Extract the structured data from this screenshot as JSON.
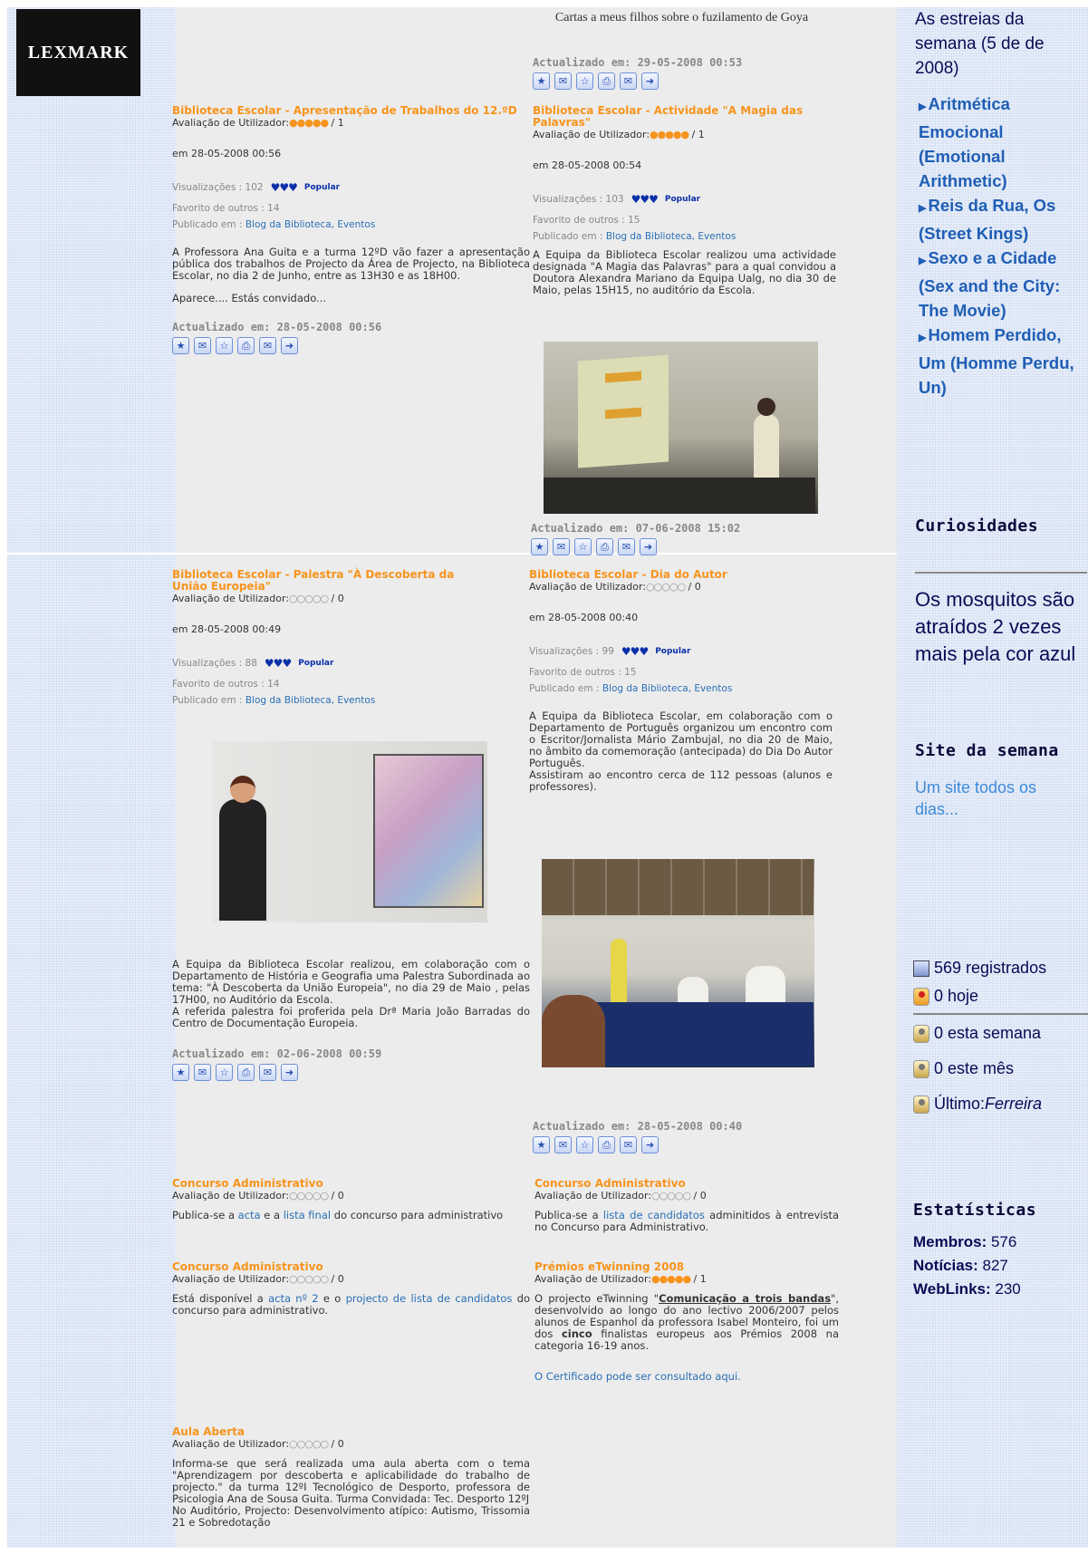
{
  "logo": {
    "text": "LEXMARK"
  },
  "top_right_article": {
    "title": "Cartas a meus filhos sobre o fuzilamento de Goya",
    "updated": "Actualizado em: 29-05-2008 00:53"
  },
  "articles": [
    {
      "title": "Biblioteca Escolar - Apresentação de Trabalhos do 12.ºD",
      "rating_label": "Avaliação de Utilizador:",
      "rating_stars": "●●●●●",
      "rating_count": " / 1",
      "date": "em 28-05-2008 00:56",
      "views": "Visualizações : 102",
      "popular": "Popular",
      "fav": "Favorito de outros : 14",
      "pub_label": "Publicado em : ",
      "pub_links": "Blog da Biblioteca, Eventos",
      "body": [
        "A Professora Ana Guita e a turma 12ºD vão fazer a apresentação pública dos trabalhos de Projecto da Área de Projecto, na Biblioteca Escolar, no dia 2 de Junho, entre as 13H30 e as 18H00.",
        "Aparece.... Estás convidado..."
      ],
      "updated": "Actualizado em: 28-05-2008 00:56"
    },
    {
      "title": "Biblioteca Escolar - Actividade \"A Magia das Palavras\"",
      "rating_label": "Avaliação de Utilizador:",
      "rating_stars": "●●●●●",
      "rating_count": " / 1",
      "date": "em 28-05-2008 00:54",
      "views": "Visualizações : 103",
      "popular": "Popular",
      "fav": "Favorito de outros : 15",
      "pub_label": "Publicado em : ",
      "pub_links": "Blog da Biblioteca, Eventos",
      "body": [
        "A Equipa da Biblioteca Escolar realizou uma actividade designada \"A Magia das Palavras\" para a qual convidou a Doutora Alexandra Mariano da Equipa Ualg, no dia 30 de Maio, pelas 15H15, no auditório da Escola."
      ],
      "updated": "Actualizado em: 07-06-2008 15:02"
    },
    {
      "title": "Biblioteca Escolar - Palestra \"À Descoberta da União Europeia\"",
      "rating_label": "Avaliação de Utilizador:",
      "rating_stars": "○○○○○",
      "rating_count": " / 0",
      "date": "em 28-05-2008 00:49",
      "views": "Visualizações : 88",
      "popular": "Popular",
      "fav": "Favorito de outros : 14",
      "pub_label": "Publicado em : ",
      "pub_links": "Blog da Biblioteca, Eventos",
      "body": [
        "A Equipa da Biblioteca Escolar realizou, em colaboração com o Departamento de História e Geografia uma Palestra Subordinada ao tema: \"À Descoberta da União Europeia\", no dia 29 de Maio , pelas 17H00, no Auditório da Escola.",
        "A referida palestra foi proferida pela Drª Maria João Barradas do Centro de Documentação Europeia."
      ],
      "updated": "Actualizado em: 02-06-2008 00:59"
    },
    {
      "title": "Biblioteca Escolar - Dia do Autor",
      "rating_label": "Avaliação de Utilizador:",
      "rating_stars": "○○○○○",
      "rating_count": " / 0",
      "date": "em 28-05-2008 00:40",
      "views": "Visualizações : 99",
      "popular": "Popular",
      "fav": "Favorito de outros : 15",
      "pub_label": "Publicado em : ",
      "pub_links": "Blog da Biblioteca, Eventos",
      "body": [
        "A Equipa da Biblioteca Escolar, em colaboração com o Departamento de Português organizou um encontro com o Escritor/Jornalista Mário Zambujal, no dia 20 de Maio, no âmbito da comemoração (antecipada) do Dia Do Autor Português.",
        "Assistiram ao encontro cerca de 112 pessoas (alunos e professores)."
      ],
      "updated": "Actualizado em: 28-05-2008 00:40"
    }
  ],
  "short_articles": {
    "ca1": {
      "title": "Concurso Administrativo",
      "rating_label": "Avaliação de Utilizador:",
      "rating_stars": "○○○○○",
      "rating_count": " / 0",
      "text_a": "Publica-se a ",
      "link_a": "acta",
      "text_b": " e a ",
      "link_b": "lista final",
      "text_c": " do concurso para administrativo"
    },
    "ca2": {
      "title": "Concurso Administrativo",
      "rating_label": "Avaliação de Utilizador:",
      "rating_stars": "○○○○○",
      "rating_count": " / 0",
      "text_a": "Publica-se a ",
      "link_a": "lista de candidatos",
      "text_b": " adminitidos à entrevista no Concurso para Administrativo."
    },
    "ca3": {
      "title": "Concurso Administrativo",
      "rating_label": "Avaliação de Utilizador:",
      "rating_stars": "○○○○○",
      "rating_count": " / 0",
      "text_a": "Está disponível a ",
      "link_a": "acta nº 2",
      "text_b": " e o ",
      "link_b": "projecto de lista de candidatos",
      "text_c": " do concurso para administrativo."
    },
    "etw": {
      "title": "Prémios eTwinning 2008",
      "rating_label": "Avaliação de Utilizador:",
      "rating_stars": "●●●●●",
      "rating_count": " / 1",
      "text_a": "O projecto eTwinning \"",
      "bold_a": "Comunicação a trois bandas",
      "text_b": "\", desenvolvido ao longo do ano lectivo 2006/2007 pelos alunos de Espanhol da professora Isabel Monteiro, foi um dos ",
      "bold_b": "cinco",
      "text_c": " finalistas europeus aos Prémios 2008 na categoria 16-19 anos.",
      "cert": "O Certificado pode ser consultado aqui."
    },
    "aula": {
      "title": "Aula Aberta",
      "rating_label": "Avaliação de Utilizador:",
      "rating_stars": "○○○○○",
      "rating_count": " / 0",
      "p1": "Informa-se que será realizada uma aula aberta com o tema \"Aprendizagem por descoberta e aplicabilidade do trabalho de projecto.\" da turma 12ºI Tecnológico de Desporto, professora de Psicologia Ana de Sousa Guita. Turma Convidada: Tec. Desporto 12ºJ",
      "p2": "No Auditório, Projecto: Desenvolvimento atípico: Autismo, Trissomia 21 e Sobredotação"
    }
  },
  "sidebar": {
    "estreias_head": "As estreias da semana (5 de de 2008)",
    "films": [
      "Aritmética Emocional (Emotional Arithmetic)",
      "Reis da Rua, Os (Street Kings)",
      "Sexo e a Cidade (Sex and the City: The Movie)",
      "Homem Perdido, Um (Homme Perdu, Un)"
    ],
    "curiosidades_head": "Curiosidades",
    "curiosidades_text": "Os mosquitos são atraídos 2 vezes mais pela cor azul",
    "site_head": "Site da semana",
    "site_text": "Um site todos os dias...",
    "registered": "569 registrados",
    "today": "0 hoje",
    "week": "0 esta semana",
    "month": "0 este mês",
    "last_label": "Último: ",
    "last_name": "Ferreira",
    "stats_head": "Estatísticas",
    "members_label": "Membros:",
    "members": " 576",
    "news_label": "Notícias:",
    "news": " 827",
    "links_label": "WebLinks:",
    "links": " 230"
  },
  "icon_names": [
    "favorite-icon",
    "comment-icon",
    "star-icon",
    "print-icon",
    "email-icon",
    "next-icon"
  ],
  "icon_glyphs": [
    "★",
    "✉",
    "☆",
    "⎙",
    "✉",
    "➜"
  ],
  "colors": {
    "title_orange": "#f7941d",
    "link_blue": "#2a6fb5",
    "sidebar_blue": "#1f5eb5"
  }
}
